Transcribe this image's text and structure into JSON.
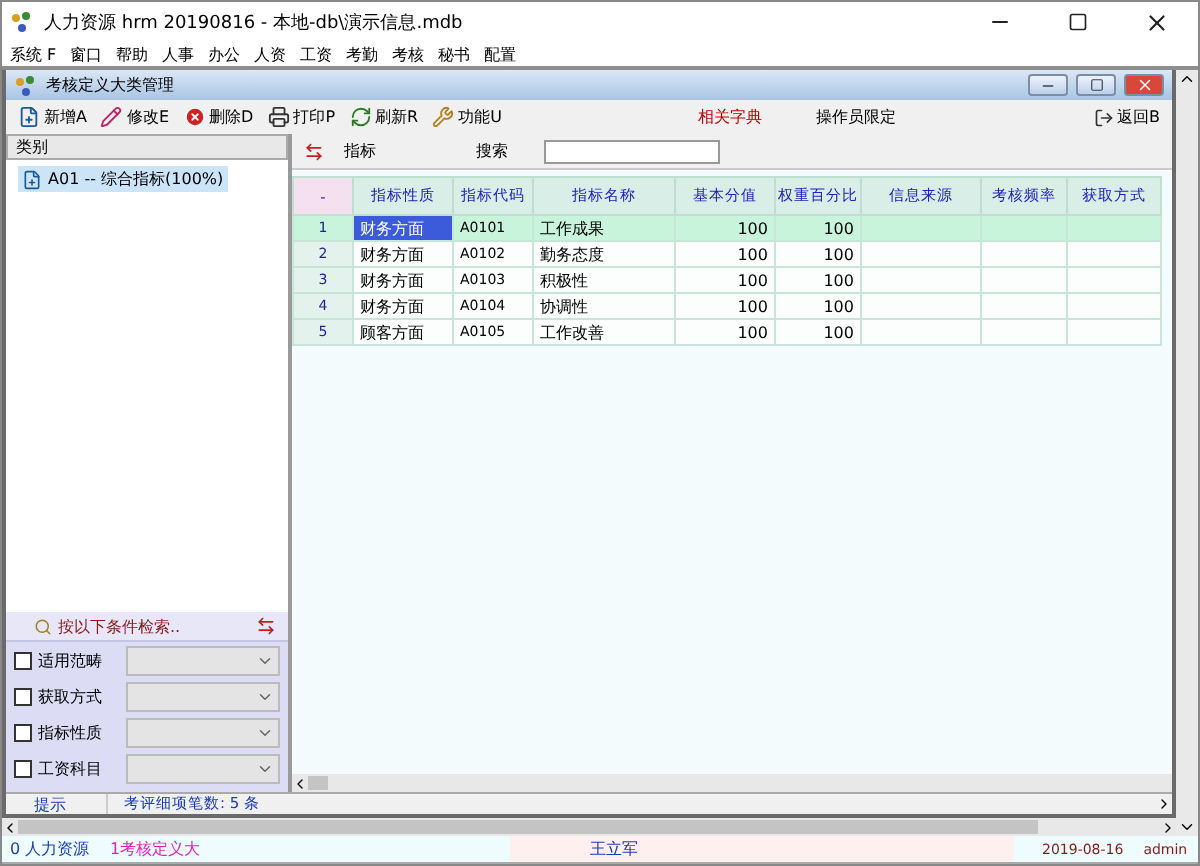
{
  "window": {
    "title": "人力资源 hrm 20190816 - 本地-db\\演示信息.mdb"
  },
  "menu": [
    "系统 F",
    "窗口",
    "帮助",
    "人事",
    "办公",
    "人资",
    "工资",
    "考勤",
    "考核",
    "秘书",
    "配置"
  ],
  "child_window": {
    "title": "考核定义大类管理"
  },
  "toolbar": [
    {
      "label": "新增A",
      "kind": "add"
    },
    {
      "label": "修改E",
      "kind": "edit"
    },
    {
      "label": "删除D",
      "kind": "delete"
    },
    {
      "label": "打印P",
      "kind": "print"
    },
    {
      "label": "刷新R",
      "kind": "refresh"
    },
    {
      "label": "功能U",
      "kind": "tools"
    }
  ],
  "links": [
    {
      "label": "相关字典",
      "kind": "highlight"
    },
    {
      "label": "操作员限定",
      "kind": "plain"
    }
  ],
  "return_button": "返回B",
  "category_panel": {
    "header": "类别",
    "tree": [
      {
        "label": "A01 -- 综合指标(100%)",
        "selected": true
      }
    ]
  },
  "grid_bar": {
    "label": "指标",
    "search_label": "搜索"
  },
  "table": {
    "corner": "-",
    "columns": [
      "指标性质",
      "指标代码",
      "指标名称",
      "基本分值",
      "权重百分比",
      "信息来源",
      "考核频率",
      "获取方式"
    ],
    "rows": [
      {
        "number": "1",
        "cells": [
          "财务方面",
          "A0101",
          "工作成果",
          "100",
          "100",
          "",
          "",
          ""
        ],
        "selected": true
      },
      {
        "number": "2",
        "cells": [
          "财务方面",
          "A0102",
          "勤务态度",
          "100",
          "100",
          "",
          "",
          ""
        ],
        "selected": false
      },
      {
        "number": "3",
        "cells": [
          "财务方面",
          "A0103",
          "积极性",
          "100",
          "100",
          "",
          "",
          ""
        ],
        "selected": false
      },
      {
        "number": "4",
        "cells": [
          "财务方面",
          "A0104",
          "协调性",
          "100",
          "100",
          "",
          "",
          ""
        ],
        "selected": false
      },
      {
        "number": "5",
        "cells": [
          "顾客方面",
          "A0105",
          "工作改善",
          "100",
          "100",
          "",
          "",
          ""
        ],
        "selected": false
      }
    ]
  },
  "filter_panel": {
    "header": "按以下条件检索..",
    "filters": [
      {
        "label": "适用范畴",
        "checked": false
      },
      {
        "label": "获取方式",
        "checked": false
      },
      {
        "label": "指标性质",
        "checked": false
      },
      {
        "label": "工资科目",
        "checked": false
      }
    ]
  },
  "hint_bar": {
    "label": "提示",
    "message": "考评细项笔数: 5 条"
  },
  "status_bar": {
    "module": "0 人力资源",
    "window": "1考核定义大",
    "user_name": "王立军",
    "date": "2019-08-16",
    "login": "admin"
  }
}
